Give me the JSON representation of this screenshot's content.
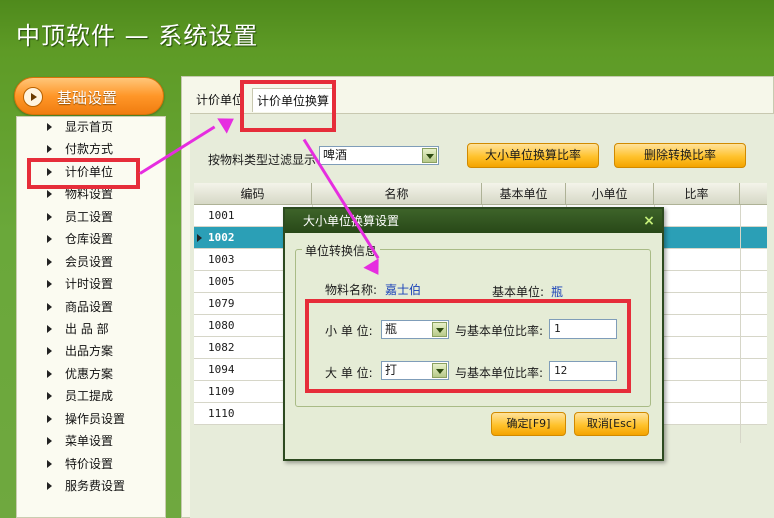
{
  "app": {
    "title": "中顶软件 — 系统设置"
  },
  "sidebar": {
    "header": "基础设置",
    "items": [
      {
        "label": "显示首页"
      },
      {
        "label": "付款方式"
      },
      {
        "label": "计价单位"
      },
      {
        "label": "物料设置"
      },
      {
        "label": "员工设置"
      },
      {
        "label": "仓库设置"
      },
      {
        "label": "会员设置"
      },
      {
        "label": "计时设置"
      },
      {
        "label": "商品设置"
      },
      {
        "label": "出 品 部"
      },
      {
        "label": "出品方案"
      },
      {
        "label": "优惠方案"
      },
      {
        "label": "员工提成"
      },
      {
        "label": "操作员设置"
      },
      {
        "label": "菜单设置"
      },
      {
        "label": "特价设置"
      },
      {
        "label": "服务费设置"
      }
    ]
  },
  "tabs": [
    {
      "label": "计价单位"
    },
    {
      "label": "计价单位换算"
    }
  ],
  "filter": {
    "label": "按物料类型过滤显示",
    "value": "啤酒"
  },
  "buttons": {
    "ratio": "大小单位换算比率",
    "delete": "删除转换比率"
  },
  "grid": {
    "columns": [
      "编码",
      "名称",
      "基本单位",
      "小单位",
      "比率"
    ],
    "rows": [
      {
        "code": "1001"
      },
      {
        "code": "1002"
      },
      {
        "code": "1003"
      },
      {
        "code": "1005"
      },
      {
        "code": "1079"
      },
      {
        "code": "1080"
      },
      {
        "code": "1082"
      },
      {
        "code": "1094"
      },
      {
        "code": "1109"
      },
      {
        "code": "1110"
      }
    ]
  },
  "dialog": {
    "title": "大小单位换算设置",
    "close": "×",
    "group_title": "单位转换信息",
    "material_label": "物料名称:",
    "material_value": "嘉士伯",
    "base_unit_label": "基本单位:",
    "base_unit_value": "瓶",
    "small_unit_label": "小 单 位:",
    "small_unit_value": "瓶",
    "small_ratio_label": "与基本单位比率:",
    "small_ratio_value": "1",
    "large_unit_label": "大 单 位:",
    "large_unit_value": "打",
    "large_ratio_label": "与基本单位比率:",
    "large_ratio_value": "12",
    "ok": "确定[F9]",
    "cancel": "取消[Esc]"
  },
  "colors": {
    "background": "#5e9b26",
    "accent_orange": "#ff9628",
    "selected_row": "#2b9fb6",
    "annotation_red": "#e62d3a",
    "annotation_magenta": "#e62de0"
  }
}
